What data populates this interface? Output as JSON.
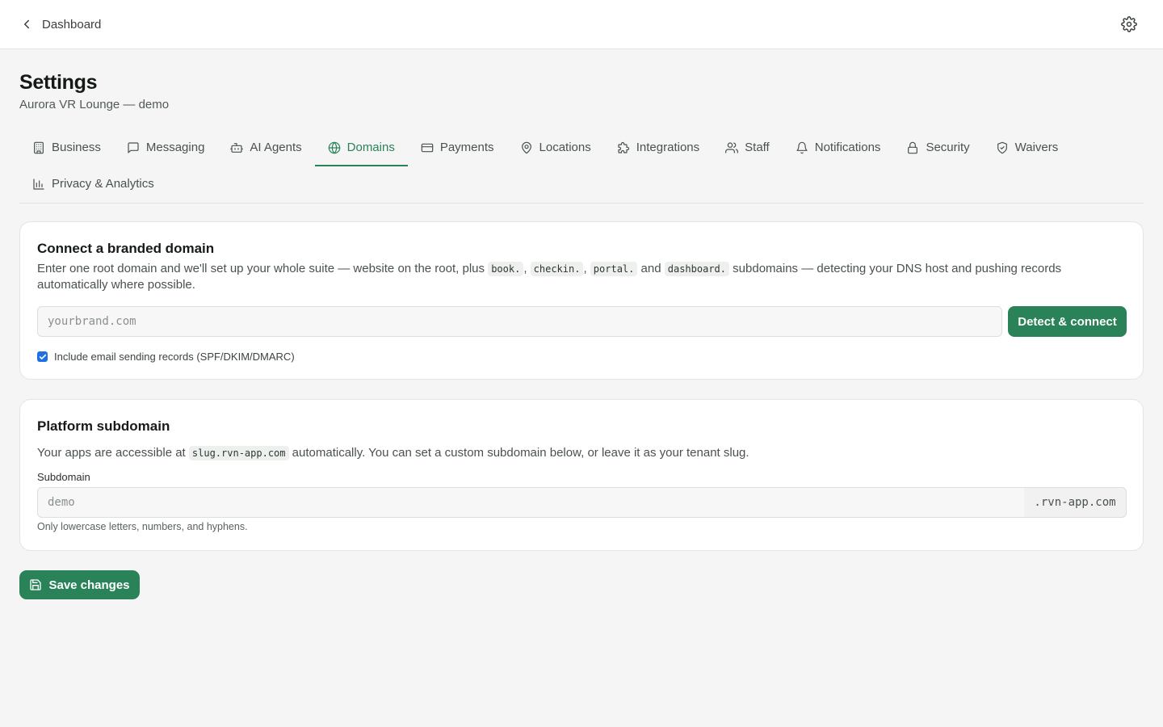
{
  "header": {
    "back_label": "Dashboard"
  },
  "page": {
    "title": "Settings",
    "subtitle": "Aurora VR Lounge — demo"
  },
  "tabs": [
    {
      "label": "Business",
      "icon": "building-icon"
    },
    {
      "label": "Messaging",
      "icon": "message-icon"
    },
    {
      "label": "AI Agents",
      "icon": "bot-icon"
    },
    {
      "label": "Domains",
      "icon": "globe-icon",
      "active": true
    },
    {
      "label": "Payments",
      "icon": "credit-card-icon"
    },
    {
      "label": "Locations",
      "icon": "map-pin-icon"
    },
    {
      "label": "Integrations",
      "icon": "puzzle-icon"
    },
    {
      "label": "Staff",
      "icon": "users-icon"
    },
    {
      "label": "Notifications",
      "icon": "bell-icon"
    },
    {
      "label": "Security",
      "icon": "lock-icon"
    },
    {
      "label": "Waivers",
      "icon": "shield-check-icon"
    },
    {
      "label": "Privacy & Analytics",
      "icon": "bar-chart-icon"
    }
  ],
  "branded_domain": {
    "title": "Connect a branded domain",
    "desc_1": "Enter one root domain and we'll set up your whole suite — website on the root, plus",
    "code_1": "book.",
    "sep_1": ",",
    "code_2": "checkin.",
    "sep_2": ",",
    "code_3": "portal.",
    "sep_3": "and",
    "code_4": "dashboard.",
    "desc_2": "subdomains — detecting your DNS host and pushing records automatically where possible.",
    "input_placeholder": "yourbrand.com",
    "button_label": "Detect & connect",
    "checkbox_label": "Include email sending records (SPF/DKIM/DMARC)",
    "checkbox_checked": true
  },
  "platform_subdomain": {
    "title": "Platform subdomain",
    "desc_1": "Your apps are accessible at",
    "code": "slug.rvn-app.com",
    "desc_2": "automatically. You can set a custom subdomain below, or leave it as your tenant slug.",
    "field_label": "Subdomain",
    "input_placeholder": "demo",
    "suffix": ".rvn-app.com",
    "hint": "Only lowercase letters, numbers, and hyphens."
  },
  "save_button_label": "Save changes",
  "colors": {
    "accent": "#2a8259",
    "background": "#f4f5f4",
    "card": "#ffffff",
    "checkbox": "#1f6fe5"
  }
}
